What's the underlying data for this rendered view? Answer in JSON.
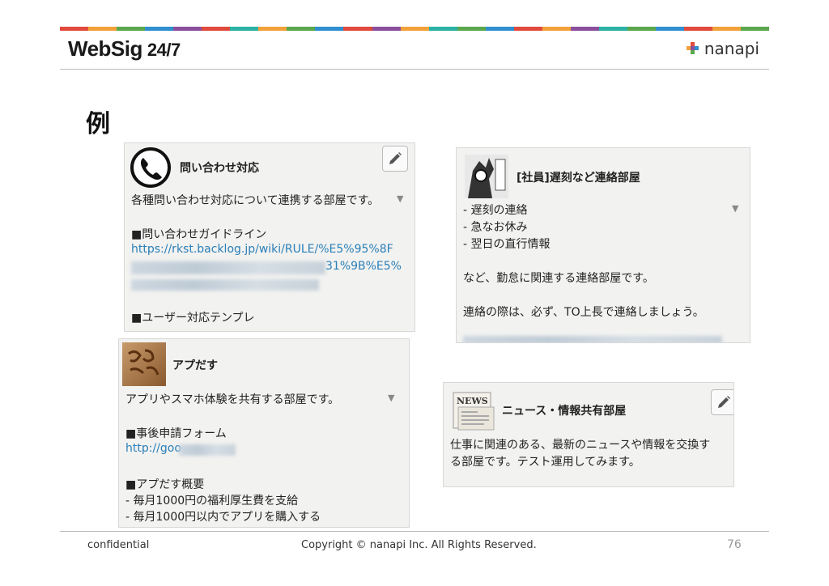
{
  "header": {
    "brand": "WebSig",
    "brand_suffix": "24/7",
    "company_logo": "nanapi",
    "stripe_colors": [
      "#e04a3c",
      "#f2a13a",
      "#5aa84b",
      "#2f8fcf",
      "#8a4f9c",
      "#e04a3c",
      "#2bb2a5",
      "#f2a13a",
      "#5aa84b",
      "#2f8fcf",
      "#e04a3c",
      "#8a4f9c",
      "#f2a13a",
      "#2bb2a5",
      "#5aa84b",
      "#2f8fcf",
      "#e04a3c",
      "#f2a13a",
      "#8a4f9c",
      "#2bb2a5",
      "#5aa84b",
      "#2f8fcf",
      "#e04a3c",
      "#f2a13a",
      "#5aa84b"
    ]
  },
  "slide": {
    "title": "例"
  },
  "cards": {
    "inquiry": {
      "title": "問い合わせ対応",
      "line1": "各種問い合わせ対応について連携する部屋です。",
      "line2": "■問い合わせガイドライン",
      "link1": "https://rkst.backlog.jp/wiki/RULE/%E5%95%8F",
      "link2_tail": "31%9B%E5%",
      "line3": "■ユーザー対応テンプレ",
      "icon": "phone-icon"
    },
    "late": {
      "title": "[社員]遅刻など連絡部屋",
      "items": [
        "- 遅刻の連絡",
        "- 急なお休み",
        "- 翌日の直行情報"
      ],
      "line1": "など、勤怠に関連する連絡部屋です。",
      "line2": "連絡の際は、必ず、TO上長で連絡しましょう。",
      "icon": "manga-avatar"
    },
    "apps": {
      "title": "アプだす",
      "line1": "アプリやスマホ体験を共有する部屋です。",
      "line2": "■事後申請フォーム",
      "link1": "http://goo",
      "line3": "■アプだす概要",
      "items": [
        "- 毎月1000円の福利厚生費を支給",
        "- 毎月1000円以内でアプリを購入する"
      ],
      "icon": "wood-logo-avatar"
    },
    "news": {
      "title": "ニュース・情報共有部屋",
      "line1": "仕事に関連のある、最新のニュースや情報を交換す",
      "line2": "る部屋です。テスト運用してみます。",
      "icon": "newspaper-icon",
      "icon_label": "NEWS"
    }
  },
  "footer": {
    "left": "confidential",
    "center": "Copyright © nanapi Inc. All Rights Reserved.",
    "page": "76"
  }
}
